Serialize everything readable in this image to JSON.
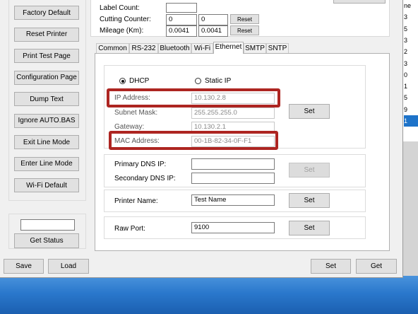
{
  "left_buttons": [
    {
      "id": "factory-default",
      "label": "Factory Default"
    },
    {
      "id": "reset-printer",
      "label": "Reset Printer"
    },
    {
      "id": "print-test-page",
      "label": "Print Test Page"
    },
    {
      "id": "configuration-page",
      "label": "Configuration Page"
    },
    {
      "id": "dump-text",
      "label": "Dump Text"
    },
    {
      "id": "ignore-auto-bas",
      "label": "Ignore AUTO.BAS"
    },
    {
      "id": "exit-line-mode",
      "label": "Exit Line Mode"
    },
    {
      "id": "enter-line-mode",
      "label": "Enter Line Mode"
    },
    {
      "id": "wifi-default",
      "label": "Wi-Fi Default"
    }
  ],
  "status": {
    "input_value": "",
    "get_status_label": "Get Status"
  },
  "counters": {
    "label_count_label": "Label Count:",
    "cutting_counter_label": "Cutting Counter:",
    "cutting_a": "0",
    "cutting_b": "0",
    "mileage_label": "Mileage (Km):",
    "mileage_a": "0.0041",
    "mileage_b": "0.0041",
    "reset_label": "Reset"
  },
  "tabs": [
    {
      "label": "Common",
      "active": false
    },
    {
      "label": "RS-232",
      "active": false
    },
    {
      "label": "Bluetooth",
      "active": false
    },
    {
      "label": "Wi-Fi",
      "active": false
    },
    {
      "label": "Ethernet",
      "active": true
    },
    {
      "label": "SMTP",
      "active": false
    },
    {
      "label": "SNTP",
      "active": false
    }
  ],
  "ethernet": {
    "dhcp_label": "DHCP",
    "static_ip_label": "Static IP",
    "mode": "dhcp",
    "ip_label": "IP Address:",
    "ip_value": "10.130.2.8",
    "subnet_label": "Subnet Mask:",
    "subnet_value": "255.255.255.0",
    "gateway_label": "Gateway:",
    "gateway_value": "10.130.2.1",
    "mac_label": "MAC Address:",
    "mac_value": "00-1B-82-34-0F-F1",
    "set_label": "Set",
    "primary_dns_label": "Primary DNS IP:",
    "primary_dns_value": "",
    "secondary_dns_label": "Secondary DNS IP:",
    "secondary_dns_value": "",
    "printer_name_label": "Printer Name:",
    "printer_name_value": "Test Name",
    "raw_port_label": "Raw Port:",
    "raw_port_value": "9100"
  },
  "bottom": {
    "save": "Save",
    "load": "Load",
    "set": "Set",
    "get": "Get"
  },
  "right_list": [
    {
      "text": "ne",
      "selected": false
    },
    {
      "text": "3",
      "selected": false
    },
    {
      "text": "5",
      "selected": false
    },
    {
      "text": "3",
      "selected": false
    },
    {
      "text": "2",
      "selected": false
    },
    {
      "text": "3",
      "selected": false
    },
    {
      "text": "0",
      "selected": false
    },
    {
      "text": "1",
      "selected": false
    },
    {
      "text": "5",
      "selected": false
    },
    {
      "text": "9",
      "selected": false
    },
    {
      "text": "1",
      "selected": true
    }
  ],
  "colors": {
    "highlight": "#ad2521",
    "selection": "#1e73c9"
  }
}
